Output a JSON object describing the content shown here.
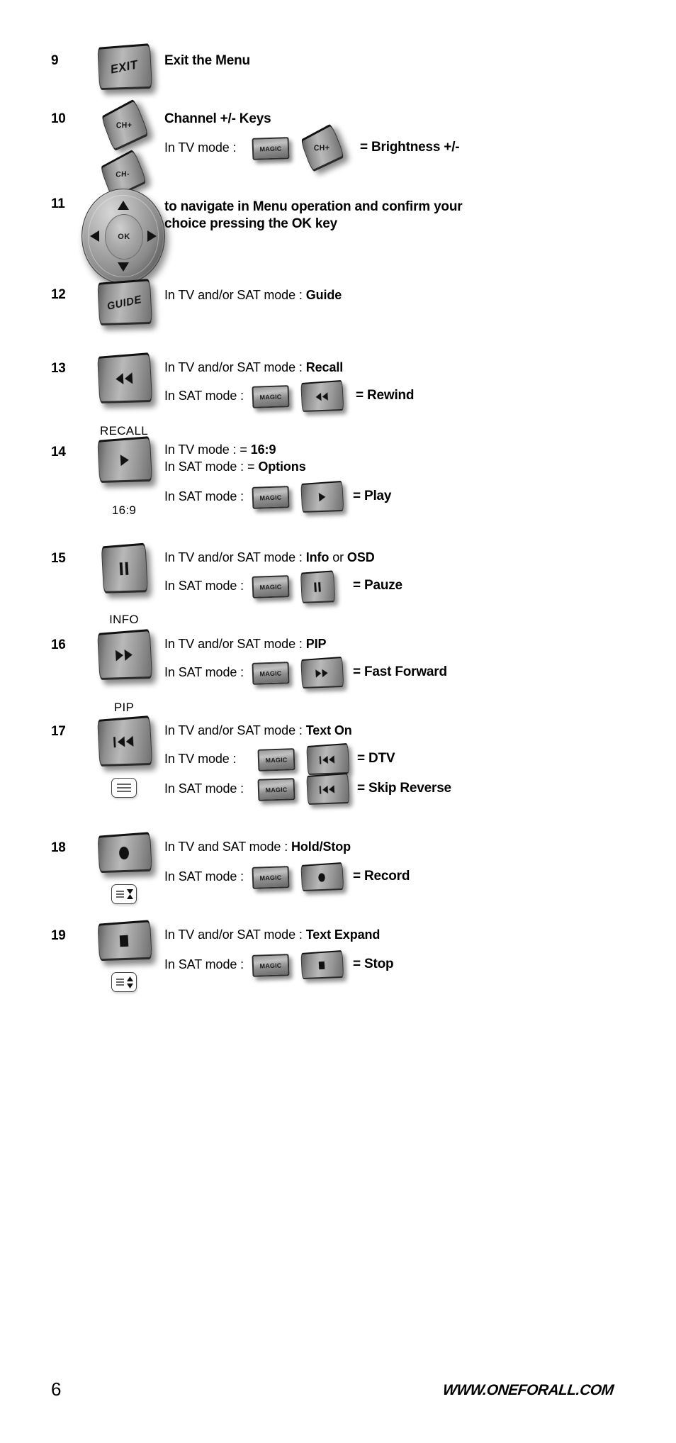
{
  "page": {
    "number": "6",
    "website": "WWW.ONEFORALL.COM"
  },
  "labels": {
    "in_tv_mode": "In TV mode :",
    "in_sat_mode": "In SAT mode :",
    "magic_key": "MAGIC",
    "ok_key": "OK"
  },
  "rows": [
    {
      "num": "9",
      "key_glyph": "EXIT",
      "key_caption": "",
      "lines": [
        {
          "prefix": "",
          "bold": "Exit the Menu",
          "style": "heading"
        }
      ]
    },
    {
      "num": "10",
      "key_glyph_up": "CH+",
      "key_glyph_down": "CH-",
      "key_caption": "",
      "lines": [
        {
          "prefix": "",
          "bold": "Channel +/- Keys",
          "style": "heading"
        },
        {
          "mode": "In TV mode :",
          "combo_key": "CH+",
          "result": "= Brightness +/-"
        }
      ]
    },
    {
      "num": "11",
      "key_glyph": "navigation-ring",
      "key_caption": "",
      "lines": [
        {
          "prefix": "",
          "bold": "to navigate in Menu operation and confirm your",
          "style": "heading"
        },
        {
          "prefix": "",
          "bold": "choice pressing the OK key",
          "style": "heading"
        }
      ]
    },
    {
      "num": "12",
      "key_glyph": "GUIDE",
      "key_caption": "",
      "lines": [
        {
          "prefix": "In TV and/or SAT mode : ",
          "bold": "Guide"
        }
      ]
    },
    {
      "num": "13",
      "key_glyph": "rewind",
      "key_caption": "RECALL",
      "lines": [
        {
          "prefix": "In TV and/or SAT mode : ",
          "bold": "Recall"
        },
        {
          "mode": "In SAT mode :",
          "combo_key": "rewind",
          "result": "= Rewind"
        }
      ]
    },
    {
      "num": "14",
      "key_glyph": "play",
      "key_caption": "16:9",
      "lines": [
        {
          "prefix": "In TV mode : = ",
          "bold": "16:9"
        },
        {
          "prefix": "In SAT mode : = ",
          "bold": "Options"
        },
        {
          "mode": "In SAT mode :",
          "combo_key": "play",
          "result": "= Play"
        }
      ]
    },
    {
      "num": "15",
      "key_glyph": "pause",
      "key_caption": "INFO",
      "lines": [
        {
          "prefix": "In TV and/or SAT mode : ",
          "bold": "Info",
          "mid": " or ",
          "bold2": "OSD"
        },
        {
          "mode": "In SAT mode :",
          "combo_key": "pause",
          "result": "= Pauze"
        }
      ]
    },
    {
      "num": "16",
      "key_glyph": "fast-forward",
      "key_caption": "PIP",
      "lines": [
        {
          "prefix": "In TV and/or SAT mode : ",
          "bold": "PIP"
        },
        {
          "mode": "In SAT mode :",
          "combo_key": "fast-forward",
          "result": "= Fast Forward"
        }
      ]
    },
    {
      "num": "17",
      "key_glyph": "skip-reverse",
      "key_caption": "",
      "sub_icon": "teletext-lines",
      "lines": [
        {
          "prefix": "In TV and/or SAT mode : ",
          "bold": "Text On"
        },
        {
          "mode": "In TV mode :",
          "combo_key": "skip-reverse",
          "result": "= DTV"
        },
        {
          "mode": "In SAT mode :",
          "combo_key": "skip-reverse",
          "result": "= Skip Reverse"
        }
      ]
    },
    {
      "num": "18",
      "key_glyph": "record",
      "key_caption": "",
      "sub_icon": "teletext-hold",
      "lines": [
        {
          "prefix": "In TV and SAT mode : ",
          "bold": "Hold/Stop"
        },
        {
          "mode": "In SAT mode :",
          "combo_key": "record",
          "result": "= Record"
        }
      ]
    },
    {
      "num": "19",
      "key_glyph": "stop",
      "key_caption": "",
      "sub_icon": "teletext-expand",
      "lines": [
        {
          "prefix": "In TV and/or SAT mode : ",
          "bold": "Text Expand"
        },
        {
          "mode": "In SAT mode :",
          "combo_key": "stop",
          "result": "= Stop"
        }
      ]
    }
  ]
}
